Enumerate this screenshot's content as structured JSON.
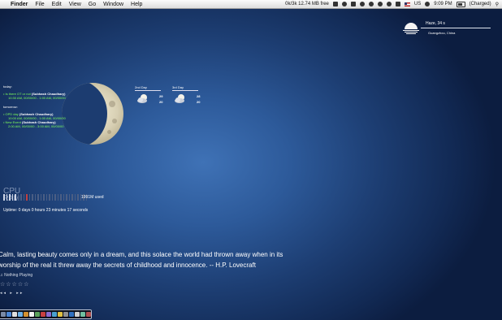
{
  "menubar": {
    "apple": "",
    "items": [
      "Finder",
      "File",
      "Edit",
      "View",
      "Go",
      "Window",
      "Help"
    ],
    "status": {
      "netstat": "0k/3k 12.74 MB free",
      "locale": "US",
      "time": "9:09 PM",
      "battery": "(Charged)"
    }
  },
  "calendar": {
    "today_label": "today:",
    "today_events": [
      {
        "title": "Is there OT or not",
        "owner": "(Subhash Chaudhary)",
        "time": "10:30 AM, 00/00/00  -  1:00 AM, 00/00/00"
      }
    ],
    "tomorrow_label": "tomorrow:",
    "tomorrow_events": [
      {
        "title": "OPD day",
        "owner": "(Subhash Chaudhary)",
        "time": "10:00 AM, 00/00/00  -  1:00 AM, 00/00/00"
      },
      {
        "title": "New Event",
        "owner": "(Subhash Chaudhary)",
        "time": "2:00 AM, 00/00/00  -  3:00 AM, 00/00/00"
      }
    ]
  },
  "weather": [
    {
      "day": "2nd Day",
      "high": "29",
      "low": "20"
    },
    {
      "day": "3rd Day",
      "high": "28",
      "low": "20"
    }
  ],
  "clock": {
    "name": "Haze, 34 s",
    "city": "Guangzhou, China"
  },
  "cpu": {
    "label": "CPU",
    "ram": "RAM",
    "mem": "1991M  used",
    "bars": 30,
    "red_index": 8
  },
  "uptime": "Uptime: 0 days 0 hours 23 minutes 17 seconds",
  "quote": {
    "text": "Calm, lasting beauty comes only in a dream, and this solace the world had thrown away when in its worship of the real it threw away the secrets of childhood and innocence.   -- H.P. Lovecraft"
  },
  "player": {
    "status": "♫ Nothing Playing",
    "stars": "☆☆☆☆☆",
    "controls": "◂◂ ▸ ▸▸"
  },
  "colors": {
    "desktop": "#2d5a9a",
    "event_green": "#7dff5a"
  }
}
